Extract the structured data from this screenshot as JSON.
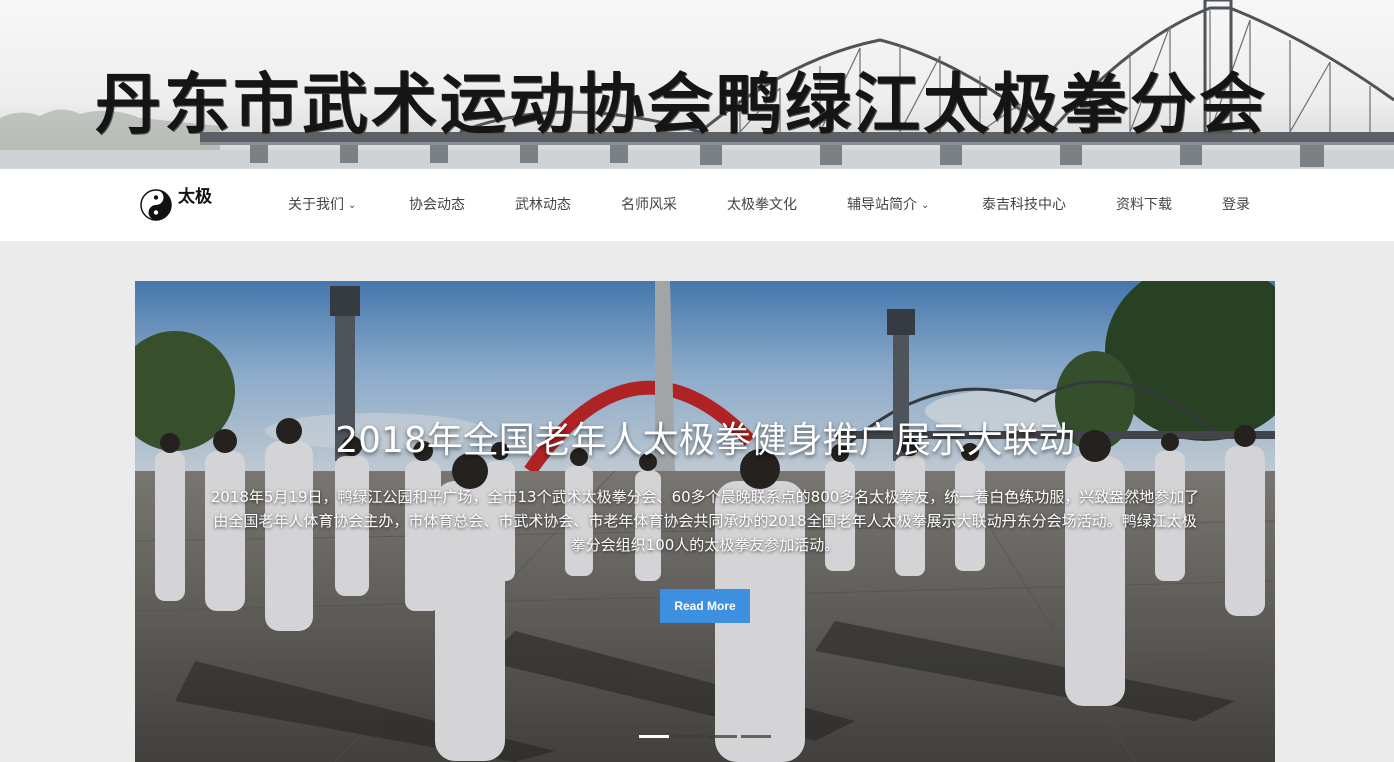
{
  "banner": {
    "title": "丹东市武术运动协会鸭绿江太极拳分会"
  },
  "nav": {
    "logo_glyph": "太极",
    "items": [
      {
        "label": "关于我们",
        "has_dropdown": true
      },
      {
        "label": "协会动态",
        "has_dropdown": false
      },
      {
        "label": "武林动态",
        "has_dropdown": false
      },
      {
        "label": "名师风采",
        "has_dropdown": false
      },
      {
        "label": "太极拳文化",
        "has_dropdown": false
      },
      {
        "label": "辅导站简介",
        "has_dropdown": true
      },
      {
        "label": "泰吉科技中心",
        "has_dropdown": false
      },
      {
        "label": "资料下载",
        "has_dropdown": false
      },
      {
        "label": "登录",
        "has_dropdown": false
      }
    ],
    "chevron": "⌄"
  },
  "slider": {
    "title": "2018年全国老年人太极拳健身推广展示大联动",
    "description": "2018年5月19日，鸭绿江公园和平广场，全市13个武术太极拳分会、60多个晨晚联系点的800多名太极拳友，统一着白色练功服，兴致盎然地参加了由全国老年人体育协会主办，市体育总会、市武术协会、市老年体育协会共同承办的2018全国老年人太极拳展示大联动丹东分会场活动。鸭绿江太极拳分会组织100人的太极拳友参加活动。",
    "button_label": "Read More",
    "slide_count": 4,
    "active_slide": 1
  },
  "colors": {
    "accent": "#3d8fe0",
    "nav_text": "#444444",
    "page_bg": "#ebebeb"
  },
  "icons": {
    "logo": "yin-yang-icon",
    "dropdown": "chevron-down-icon"
  }
}
